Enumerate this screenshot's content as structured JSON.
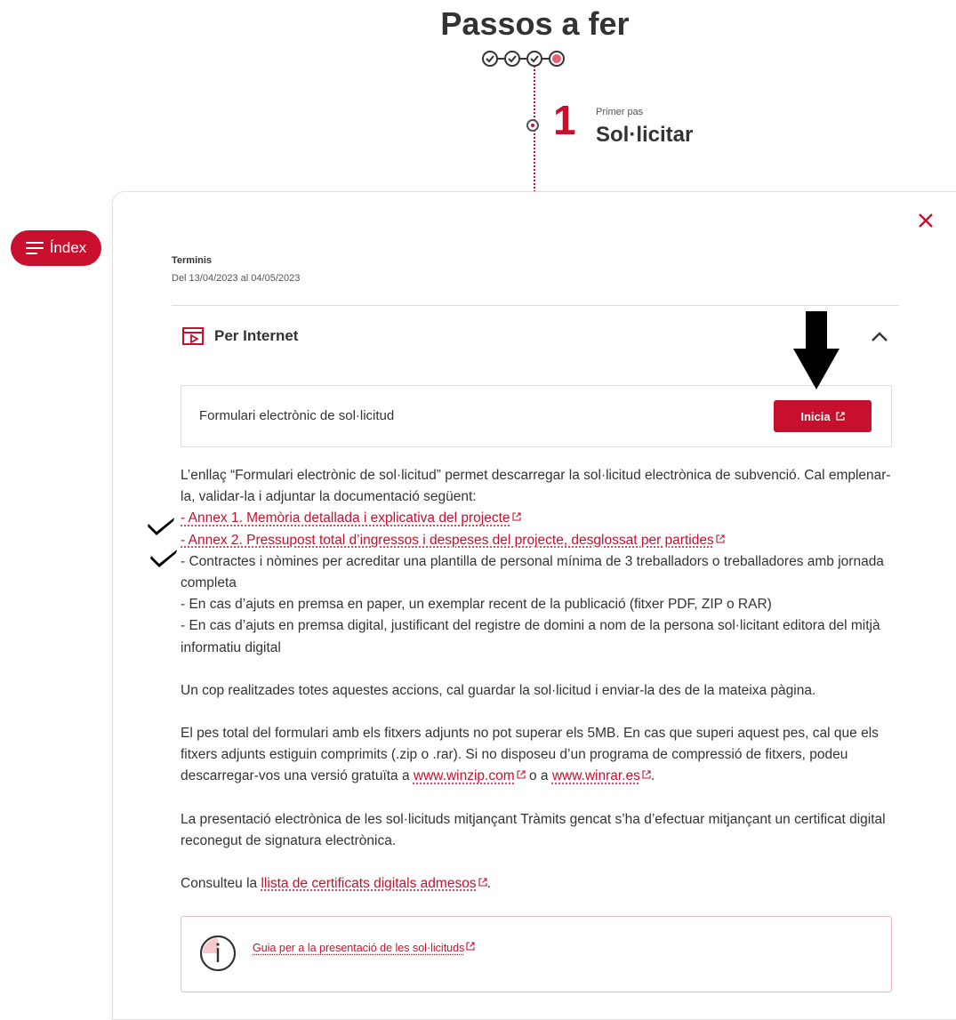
{
  "header": {
    "title": "Passos a fer",
    "step_number": "1",
    "step_kicker": "Primer pas",
    "step_title": "Sol·licitar"
  },
  "index_button": {
    "label": "Índex"
  },
  "deadlines": {
    "label": "Terminis",
    "value": "Del 13/04/2023 al 04/05/2023"
  },
  "channel": {
    "title": "Per Internet",
    "icon": "web-form-icon",
    "form_label": "Formulari electrònic de sol·licitud",
    "start_button": "Inicia"
  },
  "content": {
    "intro": "L’enllaç “Formulari electrònic de sol·licitud” permet descarregar la sol·licitud electrònica de subvenció. Cal emplenar-la, validar-la i adjuntar la documentació següent:",
    "item_prefix": "- ",
    "annex1_link": "Annex 1. Memòria detallada i explicativa del projecte",
    "annex2_link": "Annex 2. Pressupost total d’ingressos i despeses del projecte, desglossat per partides",
    "item_contracts": "- Contractes i nòmines per acreditar una plantilla de personal mínima de 3 treballadors o treballadores amb jornada completa",
    "item_paper": "- En cas d’ajuts en premsa en paper, un exemplar recent de la publicació (fitxer PDF, ZIP o RAR)",
    "item_digital": "- En cas d’ajuts en premsa digital, justificant del registre de domini a nom de la persona sol·licitant editora del mitjà informatiu digital",
    "save_send": "Un cop realitzades totes aquestes accions, cal guardar la sol·licitud i enviar-la des de la mateixa pàgina.",
    "weight_text": "El pes total del formulari amb els fitxers adjunts no pot superar els 5MB. En cas que superi aquest pes, cal que els fitxers adjunts estiguin comprimits (.zip o .rar). Si no disposeu d’un programa de compressió de fitxers, podeu descarregar-vos una versió gratuïta a",
    "winzip_link": "www.winzip.com",
    "or_text": "o a",
    "winrar_link": "www.winrar.es",
    "period": ".",
    "certificate_text": "La presentació electrònica de les sol·licituds mitjançant Tràmits gencat s’ha d’efectuar mitjançant un certificat digital reconegut de signatura electrònica.",
    "consult_prefix": "Consulteu la",
    "cert_list_link": "llista de certificats digitals admesos",
    "guide_link": "Guia per a la presentació de les sol·licituds"
  },
  "colors": {
    "accent": "#c8102e",
    "text": "#333333",
    "border": "#dcdcdc"
  }
}
